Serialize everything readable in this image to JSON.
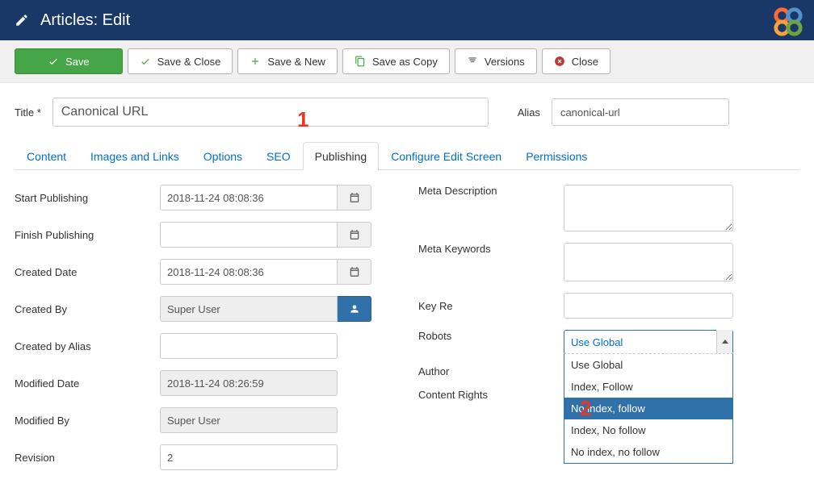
{
  "header": {
    "title": "Articles: Edit"
  },
  "toolbar": {
    "save": "Save",
    "save_close": "Save & Close",
    "save_new": "Save & New",
    "save_copy": "Save as Copy",
    "versions": "Versions",
    "close": "Close"
  },
  "form": {
    "title_label": "Title *",
    "title_value": "Canonical URL",
    "alias_label": "Alias",
    "alias_value": "canonical-url"
  },
  "tabs": [
    "Content",
    "Images and Links",
    "Options",
    "SEO",
    "Publishing",
    "Configure Edit Screen",
    "Permissions"
  ],
  "active_tab": 4,
  "left_fields": {
    "start_publishing": {
      "label": "Start Publishing",
      "value": "2018-11-24 08:08:36"
    },
    "finish_publishing": {
      "label": "Finish Publishing",
      "value": ""
    },
    "created_date": {
      "label": "Created Date",
      "value": "2018-11-24 08:08:36"
    },
    "created_by": {
      "label": "Created By",
      "value": "Super User"
    },
    "created_by_alias": {
      "label": "Created by Alias",
      "value": ""
    },
    "modified_date": {
      "label": "Modified Date",
      "value": "2018-11-24 08:26:59"
    },
    "modified_by": {
      "label": "Modified By",
      "value": "Super User"
    },
    "revision": {
      "label": "Revision",
      "value": "2"
    }
  },
  "right_fields": {
    "meta_description": {
      "label": "Meta Description"
    },
    "meta_keywords": {
      "label": "Meta Keywords"
    },
    "key_reference": {
      "label": "Key Re"
    },
    "robots": {
      "label": "Robots"
    },
    "author": {
      "label": "Author"
    },
    "content_rights": {
      "label": "Content Rights"
    }
  },
  "robots_select": {
    "selected": "Use Global",
    "options": [
      "Use Global",
      "Index, Follow",
      "No index, follow",
      "Index, No follow",
      "No index, no follow"
    ],
    "highlighted_index": 2
  },
  "annotations": {
    "a1": "1",
    "a2": "2"
  }
}
